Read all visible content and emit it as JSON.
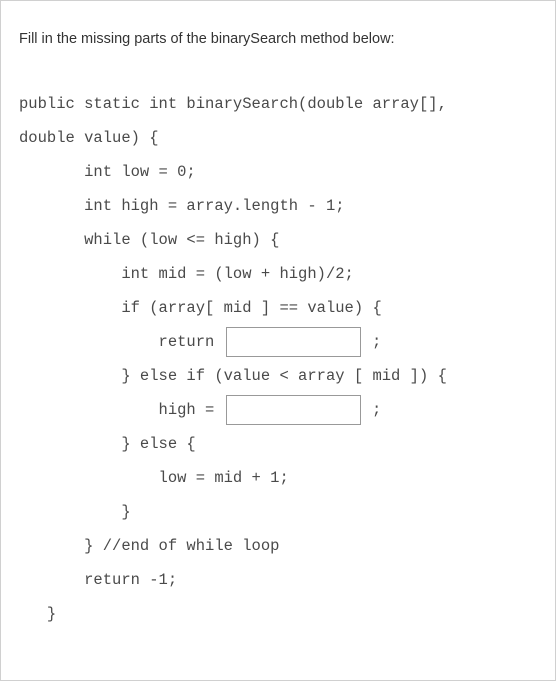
{
  "prompt": "Fill in the missing parts of the binarySearch method below:",
  "code": {
    "l1": "public static int binarySearch(double array[],",
    "l2": "double value) {",
    "l3": "       int low = 0;",
    "l4": "       int high = array.length - 1;",
    "l5": "       while (low <= high) {",
    "l6": "           int mid = (low + high)/2;",
    "l7": "           if (array[ mid ] == value) {",
    "l8a": "               return ",
    "l8b": " ;",
    "l9": "           } else if (value < array [ mid ]) {",
    "l10a": "               high = ",
    "l10b": " ;",
    "l11": "           } else {",
    "l12": "               low = mid + 1;",
    "l13": "           }",
    "l14": "       } //end of while loop",
    "l15": "       return -1;",
    "l16": "   }"
  },
  "blanks": {
    "blank1": "",
    "blank2": ""
  }
}
